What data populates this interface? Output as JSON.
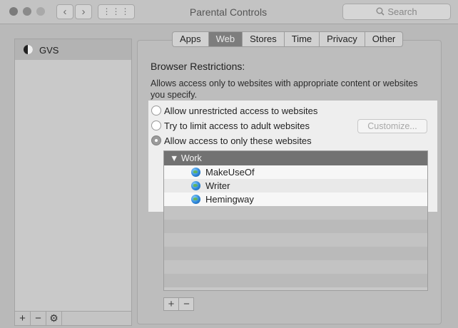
{
  "window": {
    "title": "Parental Controls",
    "search_placeholder": "Search",
    "back_glyph": "‹",
    "forward_glyph": "›",
    "grid_glyph": "⋮⋮⋮"
  },
  "sidebar": {
    "accounts": [
      {
        "name": "GVS",
        "icon": "yin-yang-icon"
      }
    ],
    "add_label": "+",
    "remove_label": "−",
    "gear_label": "⚙"
  },
  "tabs": [
    {
      "label": "Apps"
    },
    {
      "label": "Web",
      "active": true
    },
    {
      "label": "Stores"
    },
    {
      "label": "Time"
    },
    {
      "label": "Privacy"
    },
    {
      "label": "Other"
    }
  ],
  "browser": {
    "heading": "Browser Restrictions:",
    "description": "Allows access only to websites with appropriate content or websites you specify.",
    "options": [
      {
        "label": "Allow unrestricted access to websites",
        "selected": false
      },
      {
        "label": "Try to limit access to adult websites",
        "selected": false
      },
      {
        "label": "Allow access to only these websites",
        "selected": true
      }
    ],
    "customize_label": "Customize...",
    "list": {
      "group": "▼ Work",
      "sites": [
        "MakeUseOf",
        "Writer",
        "Hemingway"
      ]
    },
    "add_label": "+",
    "remove_label": "−"
  },
  "colors": {
    "active_tab": "#7d7d7d",
    "list_header": "#727272",
    "highlight": "#eeeeee"
  }
}
